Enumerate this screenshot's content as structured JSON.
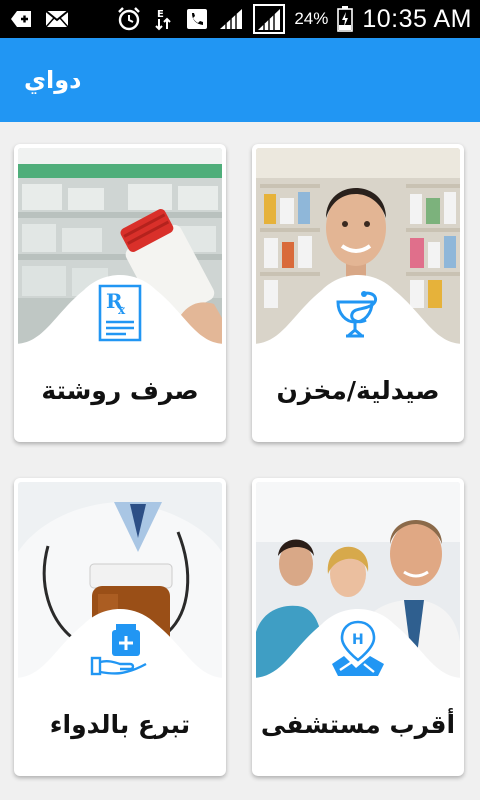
{
  "status_bar": {
    "battery_percent": "24%",
    "time": "10:35 AM",
    "left_icons": [
      "add-box-icon",
      "mail-icon"
    ],
    "right_icons": [
      "alarm-icon",
      "data-transfer-icon",
      "phone-icon",
      "signal-icon",
      "signal-icon",
      "battery-icon"
    ]
  },
  "app_bar": {
    "title": "دواي",
    "color": "#2196f3"
  },
  "cards": [
    {
      "label": "صيدلية/مخزن",
      "icon": "pharmacy-bowl-icon"
    },
    {
      "label": "صرف روشتة",
      "icon": "prescription-rx-icon"
    },
    {
      "label": "أقرب مستشفى",
      "icon": "hospital-map-icon"
    },
    {
      "label": "تبرع بالدواء",
      "icon": "donate-medicine-icon"
    }
  ],
  "accent_color": "#2196f3"
}
